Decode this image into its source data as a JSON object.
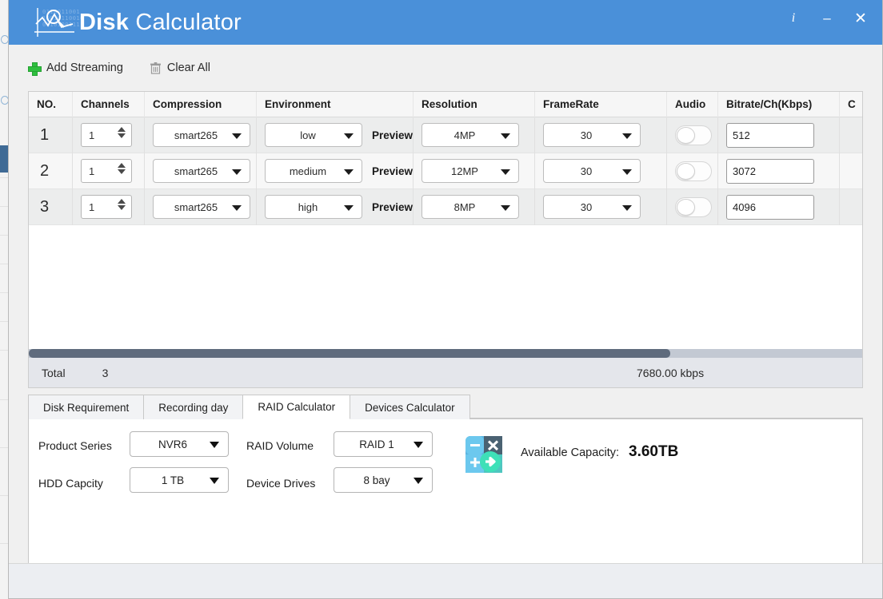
{
  "window": {
    "title_bold": "Disk",
    "title_light": " Calculator",
    "accent_color": "#4a90d9",
    "controls": {
      "info": "i",
      "minimize": "–",
      "close": "✕"
    }
  },
  "toolbar": {
    "add_streaming": "Add Streaming",
    "clear_all": "Clear All"
  },
  "table": {
    "headers": {
      "no": "NO.",
      "channels": "Channels",
      "compression": "Compression",
      "environment": "Environment",
      "resolution": "Resolution",
      "framerate": "FrameRate",
      "audio": "Audio",
      "bitrate": "Bitrate/Ch(Kbps)",
      "cut_off": "C"
    },
    "preview_label": "Preview",
    "rows": [
      {
        "no": "1",
        "channels": "1",
        "compression": "smart265",
        "environment": "low",
        "resolution": "4MP",
        "framerate": "30",
        "audio_on": false,
        "bitrate": "512"
      },
      {
        "no": "2",
        "channels": "1",
        "compression": "smart265",
        "environment": "medium",
        "resolution": "12MP",
        "framerate": "30",
        "audio_on": false,
        "bitrate": "3072"
      },
      {
        "no": "3",
        "channels": "1",
        "compression": "smart265",
        "environment": "high",
        "resolution": "8MP",
        "framerate": "30",
        "audio_on": false,
        "bitrate": "4096"
      }
    ]
  },
  "total": {
    "label": "Total",
    "count": "3",
    "bitrate_sum": "7680.00 kbps"
  },
  "tabs": [
    {
      "label": "Disk Requirement",
      "active": false
    },
    {
      "label": "Recording day",
      "active": false
    },
    {
      "label": "RAID Calculator",
      "active": true
    },
    {
      "label": "Devices Calculator",
      "active": false
    }
  ],
  "raid_panel": {
    "product_series_label": "Product Series",
    "product_series_value": "NVR6",
    "raid_volume_label": "RAID Volume",
    "raid_volume_value": "RAID 1",
    "hdd_capacity_label": "HDD Capcity",
    "hdd_capacity_value": "1 TB",
    "device_drives_label": "Device Drives",
    "device_drives_value": "8 bay",
    "available_capacity_label": "Available Capacity:",
    "available_capacity_value": "3.60TB",
    "calc_icon_symbols": {
      "minus": "−",
      "times": "×",
      "plus": "+",
      "arrow": "➜"
    }
  }
}
